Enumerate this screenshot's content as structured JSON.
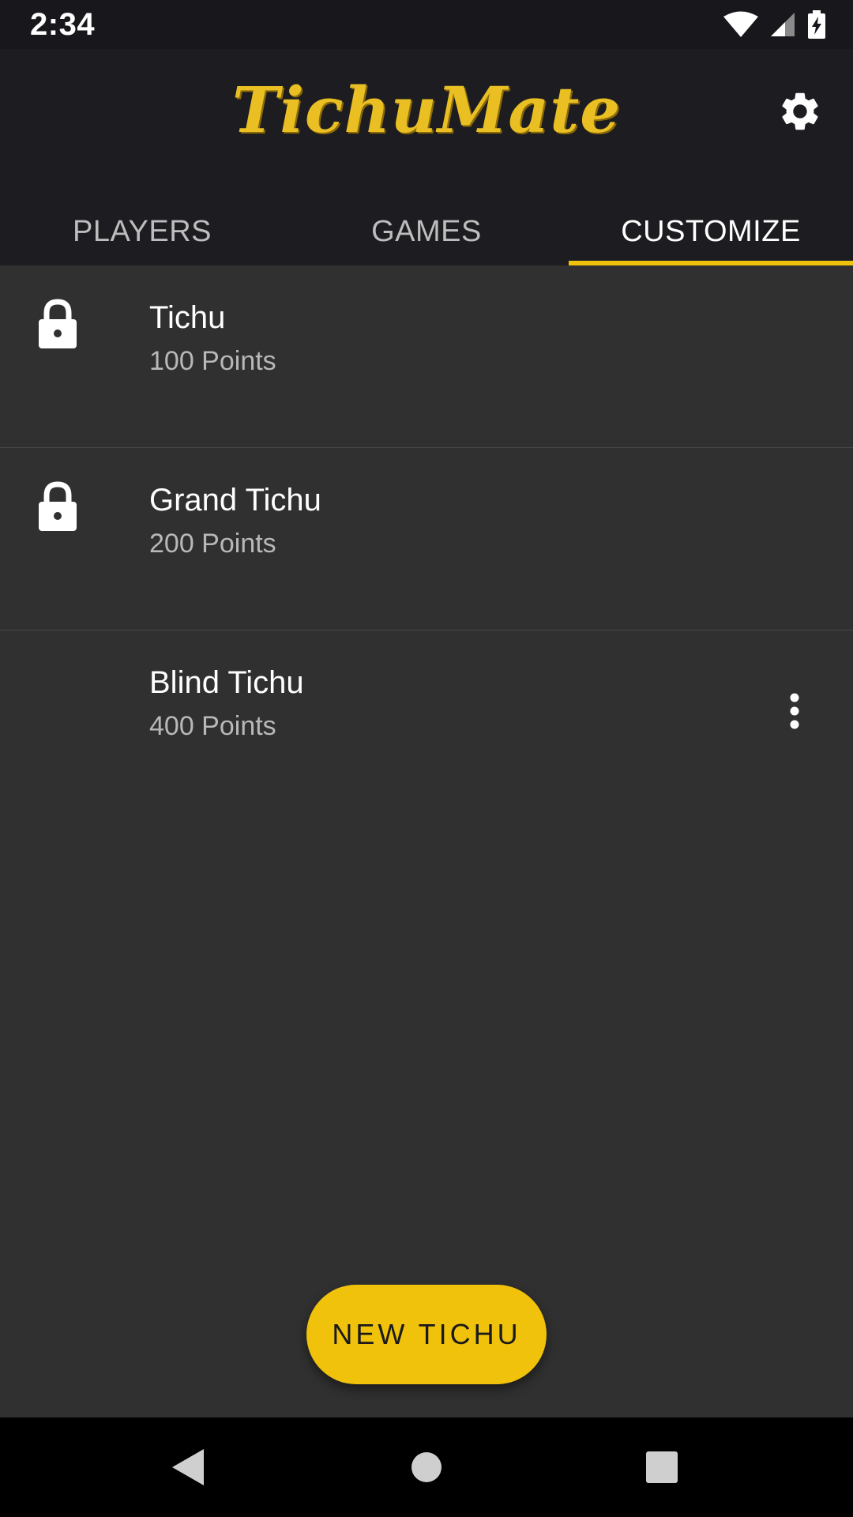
{
  "status_bar": {
    "time": "2:34",
    "icons": [
      "wifi-icon",
      "signal-icon",
      "battery-charging-icon"
    ]
  },
  "app_bar": {
    "logo_text": "TichuMate",
    "settings_icon": "gear-icon"
  },
  "tabs": [
    {
      "label": "PLAYERS",
      "active": false
    },
    {
      "label": "GAMES",
      "active": false
    },
    {
      "label": "CUSTOMIZE",
      "active": true
    }
  ],
  "items": [
    {
      "title": "Tichu",
      "subtitle": "100 Points",
      "icon": "lock-icon"
    },
    {
      "title": "Grand Tichu",
      "subtitle": "200 Points",
      "icon": "lock-icon"
    },
    {
      "title": "Blind Tichu",
      "subtitle": "400 Points",
      "icon": "more-vert-icon"
    }
  ],
  "fab": {
    "label": "NEW TICHU"
  },
  "nav_bar": {
    "icons": [
      "back-icon",
      "home-icon",
      "recents-icon"
    ]
  },
  "colors": {
    "accent": "#f1c20b",
    "background": "#303030",
    "app_bar": "#1c1c21",
    "status_bar": "#17171c"
  }
}
